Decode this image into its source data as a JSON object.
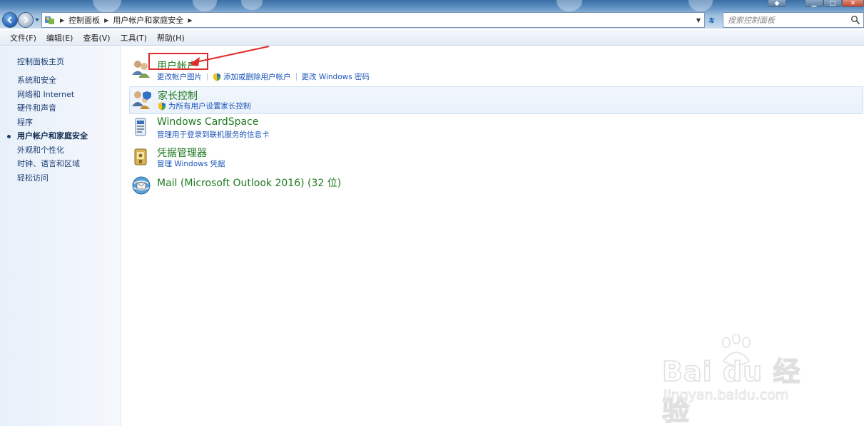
{
  "window": {
    "breadcrumb": [
      "控制面板",
      "用户帐户和家庭安全"
    ],
    "search_placeholder": "搜索控制面板"
  },
  "menubar": {
    "items": [
      "文件(F)",
      "编辑(E)",
      "查看(V)",
      "工具(T)",
      "帮助(H)"
    ]
  },
  "sidebar": {
    "home": "控制面板主页",
    "items": [
      {
        "label": "系统和安全"
      },
      {
        "label": "网络和 Internet"
      },
      {
        "label": "硬件和声音"
      },
      {
        "label": "程序"
      },
      {
        "label": "用户帐户和家庭安全",
        "current": true
      },
      {
        "label": "外观和个性化"
      },
      {
        "label": "时钟、语言和区域"
      },
      {
        "label": "轻松访问"
      }
    ]
  },
  "main": {
    "categories": [
      {
        "title": "用户帐户",
        "icon": "users-icon",
        "links": [
          "更改帐户图片",
          "添加或删除用户帐户",
          "更改 Windows 密码"
        ]
      },
      {
        "title": "家长控制",
        "icon": "parental-control-icon",
        "links": [
          "为所有用户设置家长控制"
        ]
      },
      {
        "title": "Windows CardSpace",
        "icon": "cardspace-icon",
        "links": [
          "管理用于登录到联机服务的信息卡"
        ]
      },
      {
        "title": "凭据管理器",
        "icon": "credential-manager-icon",
        "links": [
          "管理 Windows 凭据"
        ]
      },
      {
        "title": "Mail (Microsoft Outlook 2016) (32 位)",
        "icon": "mail-icon",
        "links": []
      }
    ]
  },
  "watermark": {
    "brand": "Bai du 经验",
    "url": "jingyan.baidu.com"
  },
  "colors": {
    "title_green": "#1f7a20",
    "link_blue": "#1c55b8",
    "annotation_red": "#e12a2a",
    "sidebar_bg": "#e8f0fa"
  }
}
